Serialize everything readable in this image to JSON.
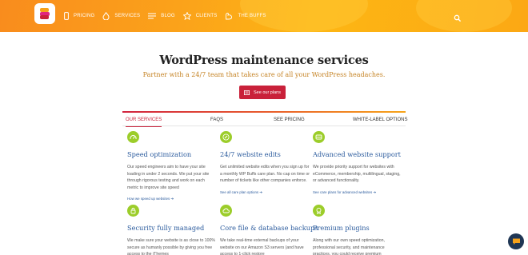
{
  "header": {
    "nav": [
      {
        "label": "PRICING",
        "icon": "phone-icon"
      },
      {
        "label": "SERVICES",
        "icon": "fire-icon"
      },
      {
        "label": "BLOG",
        "icon": "menu-lines-icon"
      },
      {
        "label": "CLIENTS",
        "icon": "star-icon"
      },
      {
        "label": "THE BUFFS",
        "icon": "flex-arm-icon"
      }
    ],
    "search_icon": "search-icon",
    "colors": {
      "gradient_start": "#f98c1d",
      "gradient_end": "#fdb614"
    }
  },
  "hero": {
    "title": "WordPress maintenance services",
    "subtitle": "Partner with a 24/7 team that takes care of all your WordPress headaches.",
    "cta_label": "See our plans",
    "cta_color": "#c9213a"
  },
  "tabs": [
    {
      "label": "OUR SERVICES",
      "active": true
    },
    {
      "label": "FAQS",
      "active": false
    },
    {
      "label": "SEE PRICING",
      "active": false
    },
    {
      "label": "WHITE-LABEL OPTIONS",
      "active": false
    }
  ],
  "services": [
    {
      "icon": "speedometer-icon",
      "title": "Speed optimization",
      "desc": "Our speed engineers aim to have your site loading in under 2 seconds. We put your site through rigorous testing and work on each metric to improve site speed",
      "link": "How we speed up websites ➔"
    },
    {
      "icon": "edit-pencil-icon",
      "title": "24/7 website edits",
      "desc": "Get unlimited website edits when you sign up for a monthly WP Buffs care plan. No cap on time or number of tickets like other companies enforce.",
      "link": "See all care plan options ➔"
    },
    {
      "icon": "layers-icon",
      "title": "Advanced website support",
      "desc": "We provide priority support for websites with eCommerce, membership, multilingual, staging, or advanced functionality.",
      "link": "See care plans for advanced websites ➔"
    },
    {
      "icon": "lock-icon",
      "title": "Security fully managed",
      "desc": "We make sure your website is as close to 100% secure as humanly possible by giving you free access to the iThemes",
      "link": ""
    },
    {
      "icon": "cloud-backup-icon",
      "title": "Core file & database backups",
      "desc": "We take real-time external backups of your website on our Amazon S3 servers (and have access to 1-click restore",
      "link": ""
    },
    {
      "icon": "badge-icon",
      "title": "Premium plugins",
      "desc": "Along with our own speed optimization, professional security, and maintenance practices, you could receive premium",
      "link": ""
    }
  ],
  "chat_icon": "chat-bubble-icon"
}
